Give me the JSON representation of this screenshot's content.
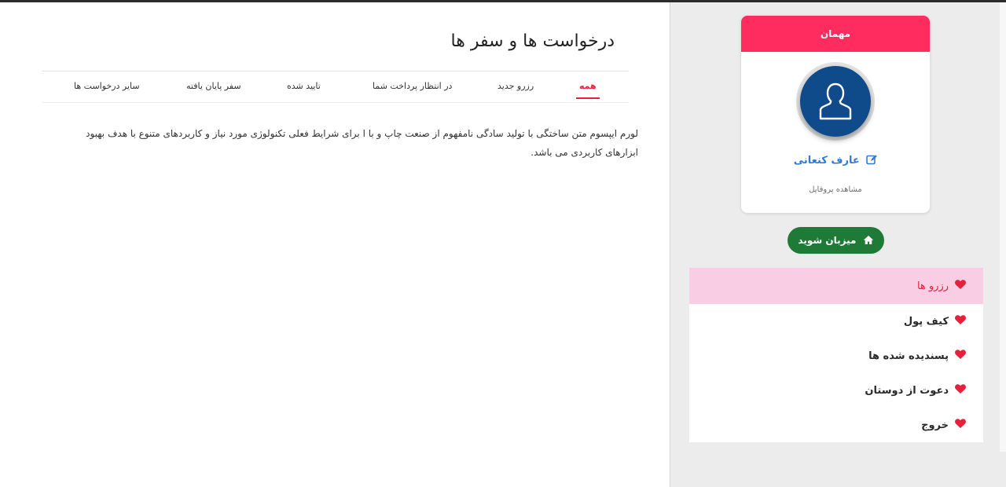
{
  "page": {
    "title": "درخواست ها و سفر ها",
    "tabs": [
      {
        "label": "همه",
        "active": true
      },
      {
        "label": "رزرو جدید",
        "active": false
      },
      {
        "label": "در انتظار پرداخت شما",
        "active": false
      },
      {
        "label": "تایید شده",
        "active": false
      },
      {
        "label": "سفر پایان یافته",
        "active": false
      },
      {
        "label": "سایر درخواست ها",
        "active": false
      }
    ],
    "body_text": "لورم ایپسوم متن ساختگی با تولید سادگی نامفهوم از صنعت چاپ و با ا برای شرایط فعلی تکنولوژی مورد نیاز و کاربردهای متنوع با هدف بهبود ابزارهای کاربردی می باشد."
  },
  "profile": {
    "header": "مهمان",
    "name": "عارف کنعانی",
    "view_profile": "مشاهده پروفایل",
    "avatar_icon": "user-silhouette-icon"
  },
  "host_button": {
    "label": "میزبان شوید",
    "icon": "home-icon"
  },
  "menu": {
    "items": [
      {
        "label": "رزرو ها",
        "active": true,
        "icon": "heart-icon"
      },
      {
        "label": "کیف پول",
        "active": false,
        "icon": "heart-icon"
      },
      {
        "label": "پسندیده شده ها",
        "active": false,
        "icon": "heart-icon"
      },
      {
        "label": "دعوت از دوستان",
        "active": false,
        "icon": "heart-icon"
      },
      {
        "label": "خروج",
        "active": false,
        "icon": "heart-icon"
      }
    ]
  },
  "colors": {
    "accent_red": "#e5203b",
    "header_pink": "#ff2d5f",
    "avatar_blue": "#0f4a8a",
    "host_green": "#1f7a37",
    "link_blue": "#2f7bd4",
    "active_menu_bg": "#f9cde3"
  }
}
